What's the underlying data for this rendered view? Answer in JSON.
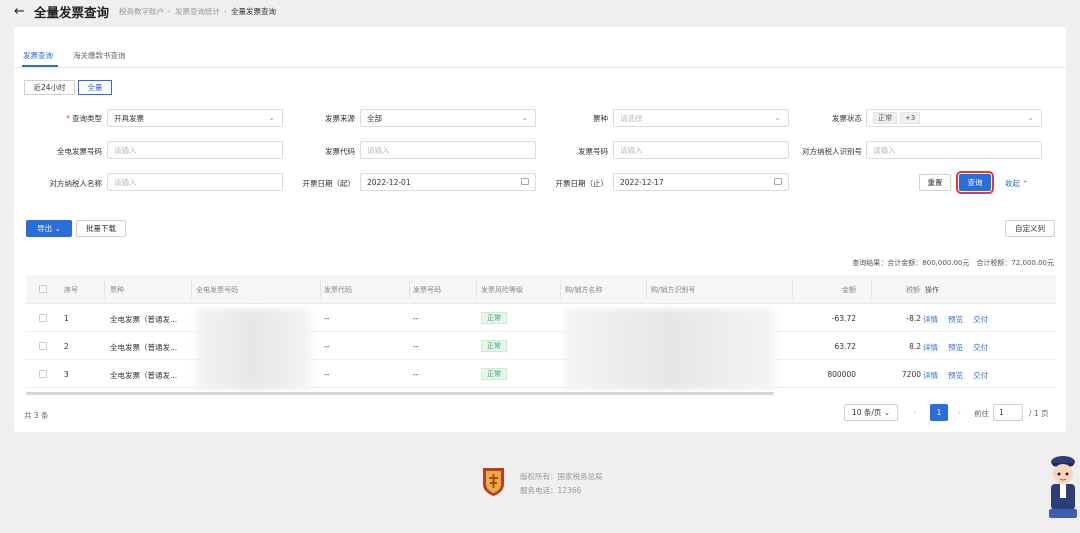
{
  "header": {
    "title": "全量发票查询",
    "breadcrumbs": [
      "税务数字账户",
      "发票查询统计",
      "全量发票查询"
    ]
  },
  "tabs": [
    "发票查询",
    "海关缴款书查询"
  ],
  "time_filter": [
    "近24小时",
    "全量"
  ],
  "form": {
    "invoice_query_type_label": "查询类型",
    "invoice_query_type_value": "开具发票",
    "invoice_source_label": "发票来源",
    "invoice_source_value": "全部",
    "ticket_type_label": "票种",
    "ticket_type_placeholder": "请选择",
    "invoice_status_label": "发票状态",
    "invoice_status_tag": "正常",
    "invoice_status_more": "+3",
    "full_invoice_number_label": "全电发票号码",
    "invoice_code_label": "发票代码",
    "invoice_number_label": "发票号码",
    "counterparty_tax_id_label": "对方纳税人识别号",
    "counterparty_name_label": "对方纳税人名称",
    "date_start_label": "开票日期（起）",
    "date_start_value": "2022-12-01",
    "date_end_label": "开票日期（止）",
    "date_end_value": "2022-12-17",
    "input_placeholder": "请输入"
  },
  "buttons": {
    "reset": "重置",
    "query": "查询",
    "collapse": "收起",
    "export": "导出",
    "batch_download": "批量下载",
    "custom_columns": "自定义列"
  },
  "summary": "查询结果：合计金额：800,000.00元　合计税额：72,000.00元",
  "table": {
    "columns": [
      "序号",
      "票种",
      "全电发票号码",
      "发票代码",
      "发票号码",
      "发票风险等级",
      "购/销方名称",
      "购/销方识别号",
      "金额",
      "税额",
      "操作"
    ],
    "rows": [
      {
        "index": "1",
        "type": "全电发票（普通发...",
        "code": "--",
        "number": "--",
        "risk": "正常",
        "amount": "-63.72",
        "tax": "-8.2"
      },
      {
        "index": "2",
        "type": "全电发票（普通发...",
        "code": "--",
        "number": "--",
        "risk": "正常",
        "amount": "63.72",
        "tax": "8.2"
      },
      {
        "index": "3",
        "type": "全电发票（普通发...",
        "code": "--",
        "number": "--",
        "risk": "正常",
        "amount": "800000",
        "tax": "7200"
      }
    ],
    "actions": [
      "详情",
      "预览",
      "交付"
    ]
  },
  "pagination": {
    "total": "共 3 条",
    "page_size": "10 条/页",
    "current_page": "1",
    "goto_label": "前往",
    "goto_value": "1",
    "page_total": "/ 1 页"
  },
  "footer": {
    "copyright": "版权所有：国家税务总局",
    "phone": "服务电话：12366"
  }
}
